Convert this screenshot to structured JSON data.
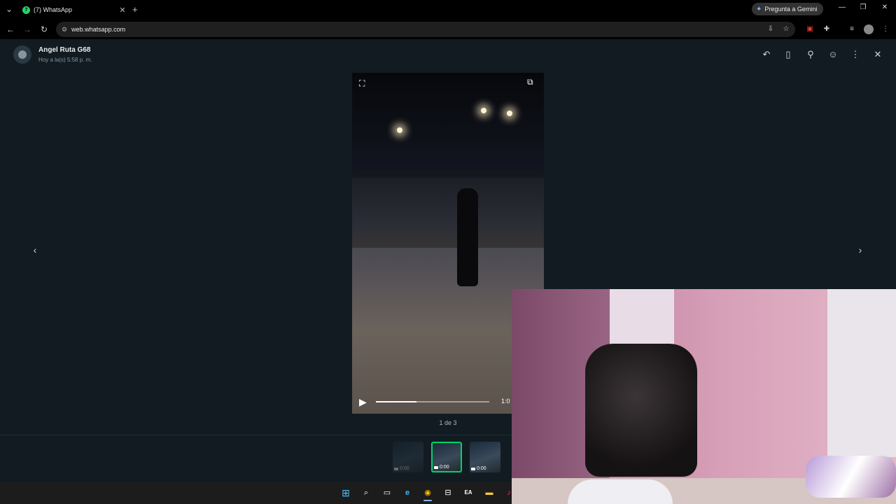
{
  "browser": {
    "tab_title": "(7) WhatsApp",
    "tab_close": "✕",
    "new_tab": "+",
    "tab_list": "⌄",
    "gemini_label": "Pregunta a Gemini",
    "url": "web.whatsapp.com",
    "window": {
      "minimize": "—",
      "restore": "❐",
      "close": "✕"
    },
    "nav": {
      "back": "←",
      "forward": "→",
      "reload": "↻"
    }
  },
  "viewer": {
    "contact_name": "Angel Ruta G68",
    "contact_time": "Hoy a la(s) 5:58 p. m.",
    "header_icons": [
      "reply-icon",
      "bookmark-icon",
      "pin-icon",
      "emoji-icon",
      "more-options-icon",
      "close-icon"
    ],
    "header_glyphs": {
      "reply": "↶",
      "bookmark": "▯",
      "pin": "⚲",
      "emoji": "☺",
      "more": "⋮",
      "close": "✕"
    },
    "prev": "‹",
    "next": "›",
    "video": {
      "fullscreen": "⛶",
      "pip": "⧉",
      "play": "▶",
      "duration": "1:0",
      "progress": 0.36
    },
    "counter": "1 de 3",
    "thumbnails": [
      {
        "time": "0:00",
        "selected": false,
        "dim": true
      },
      {
        "time": "0:00",
        "selected": true,
        "dim": false
      },
      {
        "time": "0:00",
        "selected": false,
        "dim": false
      }
    ]
  },
  "taskbar": {
    "icons": [
      "windows-start-icon",
      "search-icon",
      "task-view-icon",
      "edge-icon",
      "chrome-icon",
      "store-icon",
      "ea-app-icon",
      "file-explorer-icon",
      "music-app-icon"
    ],
    "glyphs": {
      "start": "⊞",
      "search": "⌕",
      "taskview": "▭",
      "edge": "e",
      "chrome": "◉",
      "store": "⊟",
      "ea": "EA",
      "explorer": "▬",
      "music": "♪"
    }
  },
  "colors": {
    "accent": "#00d26a",
    "viewer_bg": "#111b21",
    "text": "#e9edef",
    "muted": "#8696a0"
  }
}
